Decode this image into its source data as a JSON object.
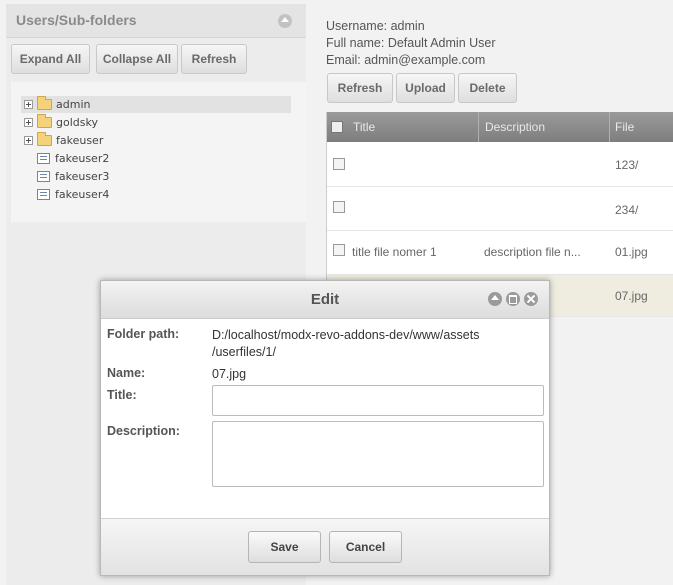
{
  "left_panel": {
    "title": "Users/Sub-folders",
    "buttons": {
      "expand_all": "Expand All",
      "collapse_all": "Collapse All",
      "refresh": "Refresh"
    },
    "tree": [
      {
        "label": "admin",
        "type": "folder",
        "selected": true
      },
      {
        "label": "goldsky",
        "type": "folder"
      },
      {
        "label": "fakeuser",
        "type": "folder"
      },
      {
        "label": "fakeuser2",
        "type": "leaf"
      },
      {
        "label": "fakeuser3",
        "type": "leaf"
      },
      {
        "label": "fakeuser4",
        "type": "leaf"
      }
    ]
  },
  "user_info": {
    "username": "Username: admin",
    "fullname": "Full name: Default Admin User",
    "email": "Email: admin@example.com"
  },
  "toolbar": {
    "refresh": "Refresh",
    "upload": "Upload",
    "delete": "Delete"
  },
  "grid": {
    "columns": [
      "Title",
      "Description",
      "File"
    ],
    "rows": [
      {
        "title": "",
        "description": "",
        "file": "123/"
      },
      {
        "title": "",
        "description": "",
        "file": "234/"
      },
      {
        "title": "title file nomer 1",
        "description": "description file n...",
        "file": "01.jpg"
      },
      {
        "title": "",
        "description": "",
        "file": "07.jpg"
      }
    ]
  },
  "edit_dialog": {
    "title": "Edit",
    "folder_path_label": "Folder path:",
    "folder_path_line1": "D:/localhost/modx-revo-addons-dev/www/assets",
    "folder_path_line2": "/userfiles/1/",
    "name_label": "Name:",
    "name_value": "07.jpg",
    "title_label": "Title:",
    "title_value": "",
    "description_label": "Description:",
    "description_value": "",
    "save": "Save",
    "cancel": "Cancel"
  }
}
